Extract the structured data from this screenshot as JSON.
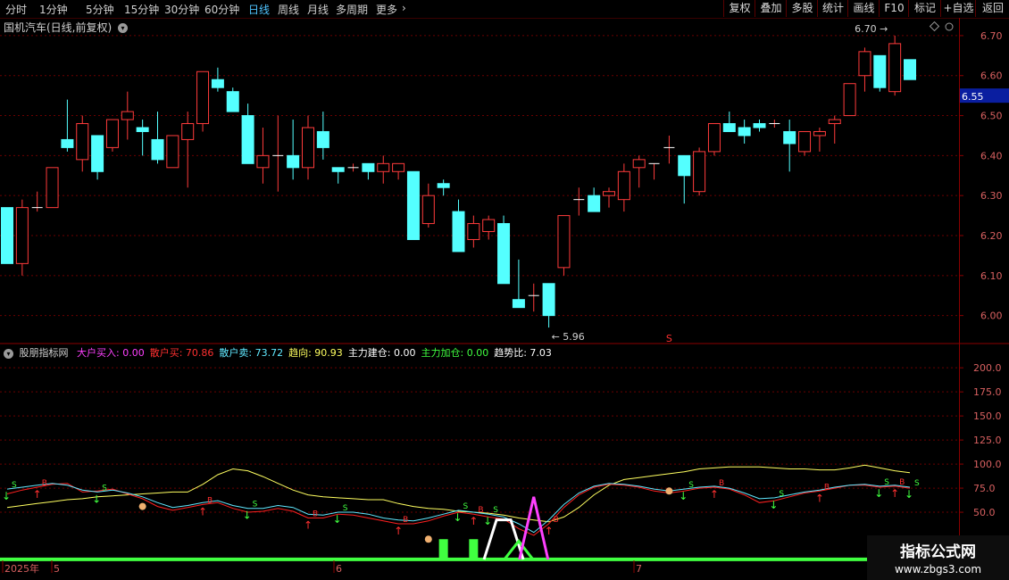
{
  "toolbar": {
    "periods": [
      "分时",
      "1分钟",
      "5分钟",
      "15分钟",
      "30分钟",
      "60分钟",
      "日线",
      "周线",
      "月线",
      "多周期",
      "更多"
    ],
    "active_period": "日线",
    "more_icon": "chevron-right-icon",
    "right_buttons": [
      "复权",
      "叠加",
      "多股",
      "统计",
      "画线",
      "F10",
      "标记",
      "+自选",
      "返回"
    ]
  },
  "price_panel": {
    "title": "国机汽车(日线,前复权)",
    "axis_ticks": [
      "6.70",
      "6.60",
      "6.50",
      "6.40",
      "6.30",
      "6.20",
      "6.10",
      "6.00"
    ],
    "last_price": "6.55",
    "high_label": "6.70",
    "low_label": "5.96",
    "marker": "S"
  },
  "indicator_panel": {
    "name": "股朋指标网",
    "fields": [
      {
        "label": "大户买入:",
        "value": "0.00",
        "color": "#ff40ff"
      },
      {
        "label": "散户买:",
        "value": "70.86",
        "color": "#ff3030"
      },
      {
        "label": "散户卖:",
        "value": "73.72",
        "color": "#60e8ff"
      },
      {
        "label": "趋向:",
        "value": "90.93",
        "color": "#ffff60"
      },
      {
        "label": "主力建仓:",
        "value": "0.00",
        "color": "#ffffff"
      },
      {
        "label": "主力加仓:",
        "value": "0.00",
        "color": "#40ff40"
      },
      {
        "label": "趋势比:",
        "value": "7.03",
        "color": "#ffffff"
      }
    ],
    "axis_ticks": [
      "200.0",
      "175.0",
      "150.0",
      "125.0",
      "100.0",
      "75.0",
      "50.0"
    ]
  },
  "date_axis": [
    "2025年",
    "5",
    "6",
    "7"
  ],
  "watermark": {
    "title": "指标公式网",
    "url": "www.zbgs3.com"
  },
  "colors": {
    "up": "#ff3b3b",
    "down": "#54ffff",
    "grid": "#6b0000",
    "border": "#8b0000",
    "yellow": "#ffff60",
    "magenta": "#ff40ff",
    "green": "#40ff40"
  },
  "chart_data": {
    "type": "candlestick",
    "series": [
      {
        "name": "daily",
        "ohlc": [
          [
            6.27,
            6.27,
            6.13,
            6.13
          ],
          [
            6.13,
            6.29,
            6.1,
            6.27
          ],
          [
            6.27,
            6.31,
            6.26,
            6.27
          ],
          [
            6.27,
            6.37,
            6.27,
            6.37
          ],
          [
            6.44,
            6.54,
            6.41,
            6.42
          ],
          [
            6.39,
            6.5,
            6.36,
            6.48
          ],
          [
            6.45,
            6.45,
            6.34,
            6.36
          ],
          [
            6.42,
            6.49,
            6.41,
            6.49
          ],
          [
            6.49,
            6.56,
            6.44,
            6.51
          ],
          [
            6.47,
            6.49,
            6.4,
            6.46
          ],
          [
            6.44,
            6.51,
            6.38,
            6.39
          ],
          [
            6.37,
            6.45,
            6.37,
            6.45
          ],
          [
            6.44,
            6.51,
            6.32,
            6.48
          ],
          [
            6.48,
            6.61,
            6.46,
            6.61
          ],
          [
            6.59,
            6.62,
            6.56,
            6.57
          ],
          [
            6.56,
            6.57,
            6.51,
            6.51
          ],
          [
            6.5,
            6.53,
            6.38,
            6.38
          ],
          [
            6.37,
            6.47,
            6.33,
            6.4
          ],
          [
            6.4,
            6.5,
            6.31,
            6.4
          ],
          [
            6.4,
            6.49,
            6.34,
            6.37
          ],
          [
            6.37,
            6.5,
            6.34,
            6.47
          ],
          [
            6.46,
            6.51,
            6.39,
            6.42
          ],
          [
            6.37,
            6.37,
            6.33,
            6.36
          ],
          [
            6.37,
            6.38,
            6.36,
            6.37
          ],
          [
            6.38,
            6.38,
            6.34,
            6.36
          ],
          [
            6.36,
            6.4,
            6.33,
            6.38
          ],
          [
            6.36,
            6.38,
            6.34,
            6.38
          ],
          [
            6.36,
            6.36,
            6.19,
            6.19
          ],
          [
            6.23,
            6.33,
            6.22,
            6.3
          ],
          [
            6.33,
            6.34,
            6.3,
            6.32
          ],
          [
            6.26,
            6.29,
            6.16,
            6.16
          ],
          [
            6.19,
            6.25,
            6.17,
            6.23
          ],
          [
            6.21,
            6.25,
            6.19,
            6.24
          ],
          [
            6.23,
            6.25,
            6.08,
            6.08
          ],
          [
            6.04,
            6.14,
            6.02,
            6.02
          ],
          [
            6.05,
            6.08,
            6.01,
            6.05
          ],
          [
            6.08,
            6.08,
            5.97,
            6.0
          ],
          [
            6.12,
            6.25,
            6.1,
            6.25
          ],
          [
            6.29,
            6.32,
            6.25,
            6.29
          ],
          [
            6.3,
            6.32,
            6.26,
            6.26
          ],
          [
            6.3,
            6.32,
            6.27,
            6.31
          ],
          [
            6.29,
            6.38,
            6.26,
            6.36
          ],
          [
            6.37,
            6.4,
            6.32,
            6.39
          ],
          [
            6.38,
            6.38,
            6.34,
            6.38
          ],
          [
            6.42,
            6.45,
            6.38,
            6.42
          ],
          [
            6.4,
            6.4,
            6.28,
            6.35
          ],
          [
            6.31,
            6.42,
            6.3,
            6.41
          ],
          [
            6.41,
            6.48,
            6.4,
            6.48
          ],
          [
            6.48,
            6.51,
            6.46,
            6.46
          ],
          [
            6.47,
            6.49,
            6.43,
            6.45
          ],
          [
            6.48,
            6.49,
            6.46,
            6.47
          ],
          [
            6.48,
            6.49,
            6.47,
            6.48
          ],
          [
            6.46,
            6.49,
            6.36,
            6.43
          ],
          [
            6.41,
            6.46,
            6.4,
            6.46
          ],
          [
            6.45,
            6.47,
            6.41,
            6.46
          ],
          [
            6.48,
            6.5,
            6.43,
            6.49
          ],
          [
            6.5,
            6.58,
            6.5,
            6.58
          ],
          [
            6.6,
            6.67,
            6.56,
            6.66
          ],
          [
            6.65,
            6.65,
            6.56,
            6.57
          ],
          [
            6.56,
            6.7,
            6.55,
            6.68
          ],
          [
            6.64,
            6.64,
            6.59,
            6.59
          ]
        ]
      }
    ],
    "price_ylim": [
      5.93,
      6.74
    ],
    "indicator": {
      "ylim": [
        0,
        215
      ],
      "yellow": [
        55,
        57,
        59,
        61,
        63,
        64,
        66,
        67,
        68,
        69,
        70,
        71,
        71,
        79,
        89,
        95,
        93,
        87,
        80,
        73,
        68,
        66,
        65,
        64,
        63,
        63,
        59,
        56,
        54,
        53,
        51,
        50,
        49,
        47,
        44,
        42,
        40,
        45,
        55,
        68,
        78,
        84,
        86,
        88,
        90,
        92,
        95,
        96,
        97,
        97,
        97,
        96,
        95,
        95,
        94,
        94,
        96,
        99,
        96,
        93,
        91
      ],
      "red": [
        69,
        73,
        76,
        79,
        80,
        71,
        72,
        74,
        69,
        64,
        56,
        52,
        55,
        58,
        60,
        54,
        50,
        51,
        54,
        51,
        44,
        44,
        48,
        47,
        44,
        41,
        38,
        38,
        41,
        46,
        50,
        48,
        45,
        43,
        33,
        26,
        38,
        55,
        68,
        76,
        79,
        78,
        76,
        72,
        70,
        72,
        75,
        76,
        74,
        68,
        60,
        62,
        66,
        70,
        72,
        75,
        78,
        78,
        76,
        77,
        75
      ],
      "cyan": [
        74,
        76,
        78,
        80,
        78,
        73,
        71,
        73,
        70,
        66,
        60,
        55,
        57,
        60,
        62,
        57,
        54,
        54,
        57,
        55,
        48,
        47,
        50,
        50,
        48,
        44,
        42,
        41,
        44,
        48,
        52,
        50,
        48,
        45,
        38,
        29,
        42,
        58,
        70,
        77,
        80,
        79,
        77,
        74,
        72,
        74,
        76,
        77,
        75,
        70,
        64,
        65,
        68,
        71,
        73,
        76,
        78,
        79,
        77,
        78,
        76
      ],
      "magenta_spike": {
        "index": 35,
        "value": 66
      },
      "white_peak": {
        "index": 33,
        "value": 42
      },
      "green_bars": [
        {
          "index": 29,
          "value": 22
        },
        {
          "index": 31,
          "value": 22
        }
      ]
    }
  }
}
